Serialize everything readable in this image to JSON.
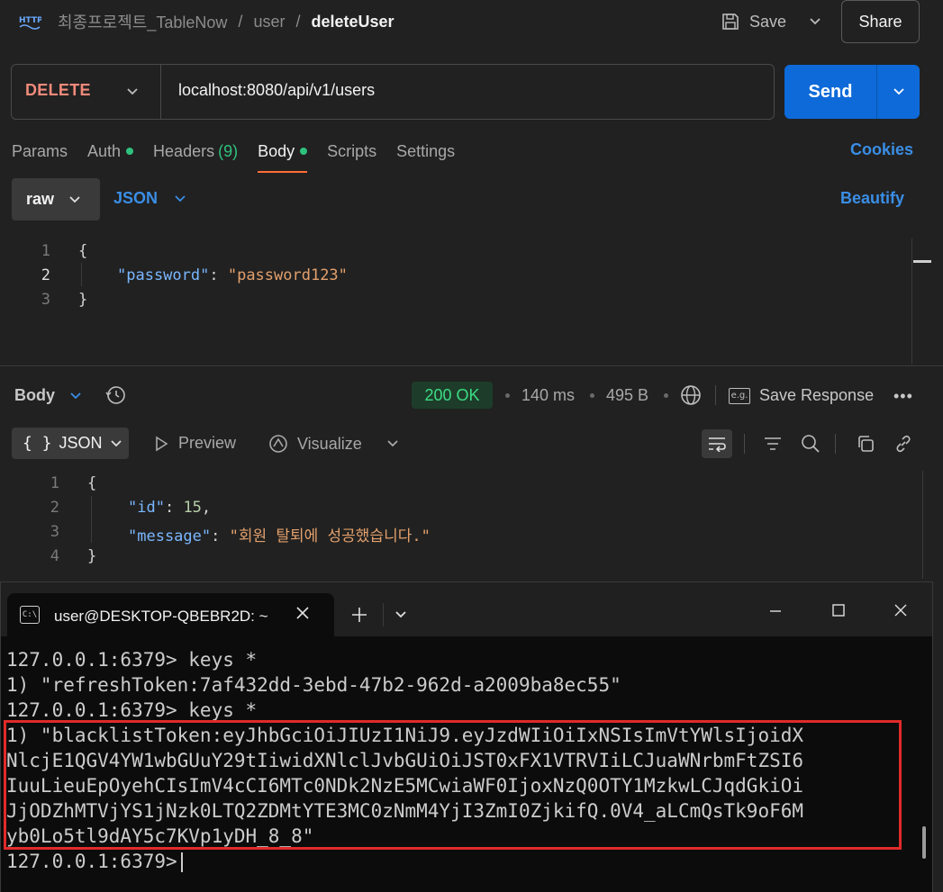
{
  "header": {
    "breadcrumb": [
      "최종프로젝트_TableNow",
      "user",
      "deleteUser"
    ],
    "separator": "/",
    "save_label": "Save",
    "share_label": "Share"
  },
  "request": {
    "method": "DELETE",
    "url": "localhost:8080/api/v1/users",
    "send_label": "Send"
  },
  "tabs": {
    "params": "Params",
    "auth": "Auth",
    "headers": "Headers",
    "headers_count": "(9)",
    "body": "Body",
    "scripts": "Scripts",
    "settings": "Settings",
    "cookies": "Cookies"
  },
  "body_mode": {
    "raw": "raw",
    "format": "JSON",
    "beautify": "Beautify"
  },
  "request_body": {
    "line_numbers": [
      "1",
      "2",
      "3"
    ],
    "open": "{",
    "key": "\"password\"",
    "colon": ": ",
    "value": "\"password123\"",
    "close": "}"
  },
  "response": {
    "label": "Body",
    "status": "200 OK",
    "time": "140 ms",
    "size": "495 B",
    "save_response": "Save Response",
    "eg_icon_text": "e.g.",
    "format": "JSON",
    "format_icon_text": "{ }",
    "preview": "Preview",
    "visualize": "Visualize",
    "line_numbers": [
      "1",
      "2",
      "3",
      "4"
    ],
    "open": "{",
    "id_key": "\"id\"",
    "id_value": "15",
    "message_key": "\"message\"",
    "message_value": "\"회원 탈퇴에 성공했습니다.\"",
    "close": "}"
  },
  "terminal": {
    "tab_title": "user@DESKTOP-QBEBR2D: ~",
    "tab_icon_text": "C:\\",
    "lines": [
      "127.0.0.1:6379> keys *",
      "1) \"refreshToken:7af432dd-3ebd-47b2-962d-a2009ba8ec55\"",
      "127.0.0.1:6379> keys *",
      "1) \"blacklistToken:eyJhbGciOiJIUzI1NiJ9.eyJzdWIiOiIxNSIsImVtYWlsIjoidX",
      "NlcjE1QGV4YW1wbGUuY29tIiwidXNlclJvbGUiOiJST0xFX1VTRVIiLCJuaWNrbmFtZSI6",
      "IuuLieuEpOyehCIsImV4cCI6MTc0NDk2NzE5MCwiaWF0IjoxNzQ0OTY1MzkwLCJqdGkiOi",
      "JjODZhMTVjYS1jNzk0LTQ2ZDMtYTE3MC0zNmM4YjI3ZmI0ZjkifQ.0V4_aLCmQsTk9oF6M",
      "yb0Lo5tl9dAY5c7KVp1yDH_8_8\""
    ],
    "prompt": "127.0.0.1:6379>"
  },
  "colors": {
    "accent_blue": "#0d6ad8",
    "method_delete": "#f08a7a",
    "status_ok": "#3ddc84",
    "active_tab": "#ff6c37",
    "highlight_box": "#e02a2a"
  }
}
